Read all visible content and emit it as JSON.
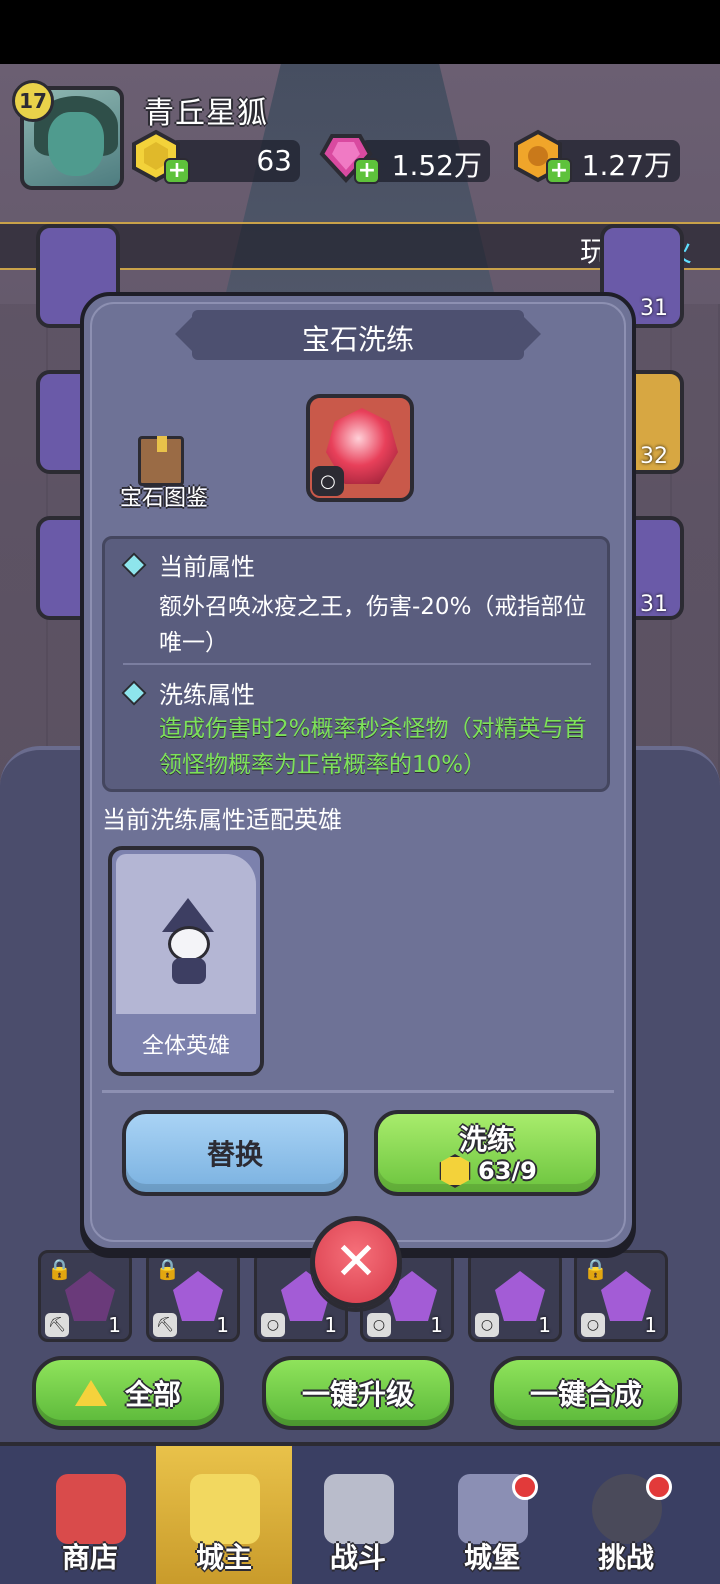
{
  "player": {
    "level": "17",
    "name": "青丘星狐"
  },
  "resources": {
    "coin": "63",
    "gem": "1.52万",
    "gold": "1.27万"
  },
  "ticker": {
    "prefix": "玩家",
    "highlight": "烟火"
  },
  "background_side_values": [
    "31",
    "32",
    "31"
  ],
  "modal": {
    "title": "宝石洗练",
    "gem_book_label": "宝石图鉴",
    "current_attr_title": "当前属性",
    "current_attr_text": "额外召唤冰疫之王，伤害-20%（戒指部位唯一）",
    "refine_attr_title": "洗练属性",
    "refine_attr_text": "造成伤害时2%概率秒杀怪物（对精英与首领怪物概率为正常概率的10%）",
    "fit_heroes_title": "当前洗练属性适配英雄",
    "hero_card_label": "全体英雄",
    "replace_button": "替换",
    "refine_button": "洗练",
    "refine_cost": "63/9"
  },
  "bottom_actions": {
    "all": "全部",
    "upgrade_all": "一键升级",
    "merge_all": "一键合成"
  },
  "slot_counts": [
    "1",
    "1",
    "1",
    "1",
    "1",
    "1"
  ],
  "nav": [
    {
      "label": "商店",
      "dot": false,
      "color": "#d94b4b"
    },
    {
      "label": "城主",
      "dot": false,
      "color": "#e9c24a"
    },
    {
      "label": "战斗",
      "dot": false,
      "color": "#b9bccb"
    },
    {
      "label": "城堡",
      "dot": true,
      "color": "#8b8fb4"
    },
    {
      "label": "挑战",
      "dot": true,
      "color": "#4a4a5a"
    }
  ],
  "colors": {
    "modal_bg": "#6e7296",
    "refine_text": "#7de25a",
    "highlight_name": "#5fe0ff"
  }
}
